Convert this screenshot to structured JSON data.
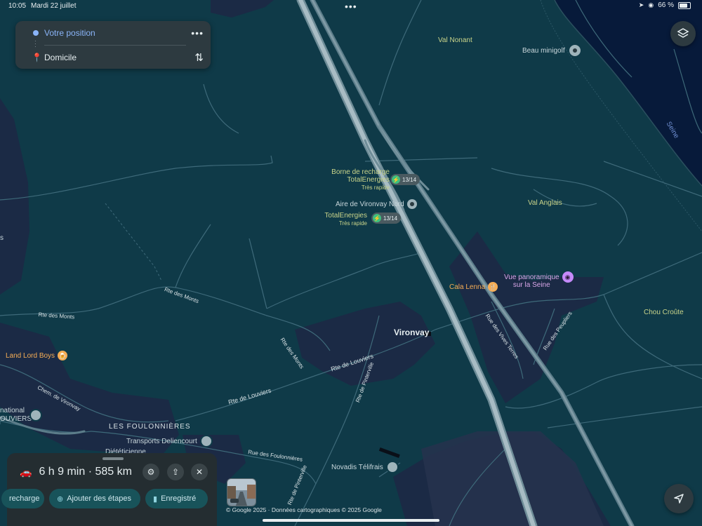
{
  "status_bar": {
    "time": "10:05",
    "date": "Mardi 22 juillet",
    "battery": "66 %"
  },
  "route": {
    "origin": "Votre position",
    "destination": "Domicile",
    "more_label": "•••"
  },
  "map": {
    "places": {
      "val_nonant": "Val Nonant",
      "beau_minigolf": "Beau minigolf",
      "seine": "Seine",
      "borne_line1": "Borne de recharge",
      "borne_line2": "TotalEnergies",
      "borne_speed": "Très rapide",
      "borne_count": "13/14",
      "aire": "Aire de Vironvay Nord",
      "total2_line1": "TotalEnergies",
      "total2_speed": "Très rapide",
      "total2_count": "13/14",
      "val_anglais": "Val Anglais",
      "vue_line1": "Vue panoramique",
      "vue_line2": "sur la Seine",
      "cala_lenna": "Cala Lenna",
      "chou_croute": "Chou Croûte",
      "vironvay": "Vironvay",
      "land_lord_boys": "Land Lord Boys",
      "foulonnieres": "LES FOULONNIÈRES",
      "transports": "Transports Deliencourt",
      "dieteticienne": "Diététicienne",
      "novadis": "Novadis Télifrais",
      "national": "national",
      "louviers": "OUVIERS",
      "s_edge": "s"
    },
    "roads": {
      "rte_des_monts_1": "Rte des Monts",
      "rte_des_monts_2": "Rte des Monts",
      "rte_des_monts_3": "Rte des Monts",
      "rte_de_louviers_1": "Rte de Louviers",
      "rte_de_louviers_2": "Rte de Louviers",
      "rte_de_pinterville_1": "Rte de Pinterville",
      "rte_de_pinterville_2": "Rte de Pinterville",
      "chem_de_vironvay": "Chem. de Vironvay",
      "rue_des_foulonnieres": "Rue des Foulonnières",
      "rue_des_vives_terres": "Rue des Vives Terres",
      "rue_des_peupliers": "Rue des Peupliers"
    }
  },
  "sheet": {
    "summary": "6 h 9 min · 585 km",
    "chips": {
      "recharge": "recharge",
      "add_stops": "Ajouter des étapes",
      "saved": "Enregistré"
    }
  },
  "copyright": "© Google 2025 · Données cartographiques © 2025 Google",
  "colors": {
    "map_background": "#0f3a48",
    "urban_area": "#1b2a45",
    "water": "#071a3a",
    "highway": "#8fa9b4",
    "origin_blue": "#8ab4f8",
    "restaurant_orange": "#f6ad55",
    "place_yellow_green": "#c9d48a"
  }
}
